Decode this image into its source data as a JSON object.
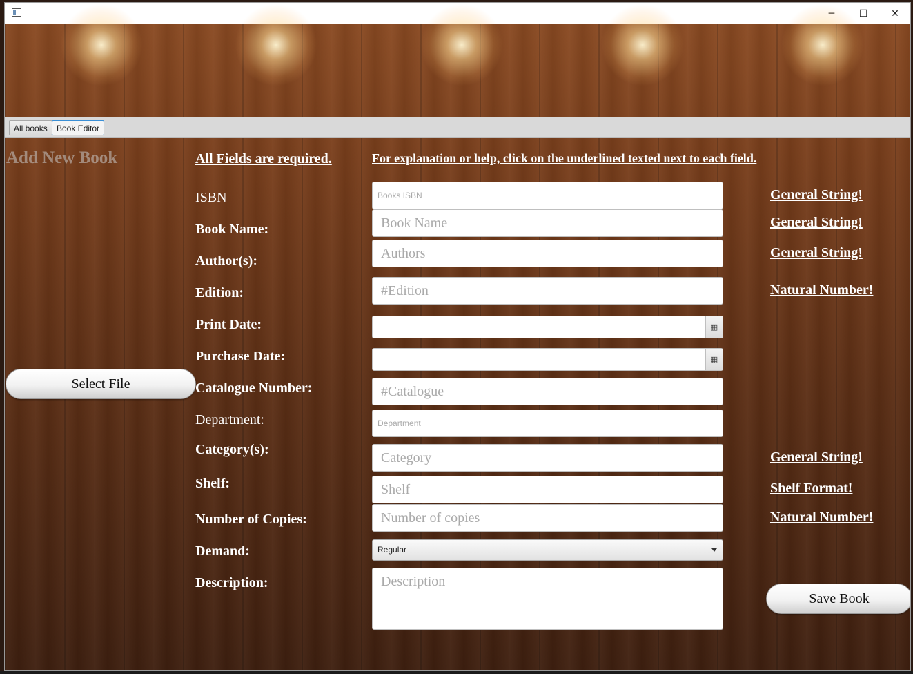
{
  "window": {
    "controls": {
      "minimize": "─",
      "maximize": "☐",
      "close": "✕"
    }
  },
  "tabs": [
    {
      "label": "All books",
      "active": false
    },
    {
      "label": "Book Editor",
      "active": true
    }
  ],
  "page": {
    "add_new_title": "Add New Book",
    "required_note": "All Fields are required.",
    "help_note": "For explanation or help, click on the underlined texted next to each field.",
    "select_file_label": "Select File",
    "save_book_label": "Save Book"
  },
  "form": {
    "isbn": {
      "label": "ISBN",
      "placeholder": "Books ISBN",
      "help": "General String!"
    },
    "book_name": {
      "label": "Book Name:",
      "placeholder": "Book Name",
      "help": "General String!"
    },
    "authors": {
      "label": "Author(s):",
      "placeholder": "Authors",
      "help": "General String!"
    },
    "edition": {
      "label": "Edition:",
      "placeholder": "#Edition",
      "help": "Natural Number!"
    },
    "print_date": {
      "label": "Print Date:",
      "value": ""
    },
    "purchase_date": {
      "label": "Purchase Date:",
      "value": ""
    },
    "catalogue_number": {
      "label": "Catalogue Number:",
      "placeholder": "#Catalogue"
    },
    "department": {
      "label": "Department:",
      "placeholder": "Department"
    },
    "categories": {
      "label": "Category(s):",
      "placeholder": "Category",
      "help": "General String!"
    },
    "shelf": {
      "label": "Shelf:",
      "placeholder": "Shelf",
      "help": "Shelf Format!"
    },
    "copies": {
      "label": "Number of Copies:",
      "placeholder": "Number of copies",
      "help": "Natural Number!"
    },
    "demand": {
      "label": "Demand:",
      "selected": "Regular"
    },
    "description": {
      "label": "Description:",
      "placeholder": "Description"
    }
  },
  "icons": {
    "calendar": "▦"
  }
}
